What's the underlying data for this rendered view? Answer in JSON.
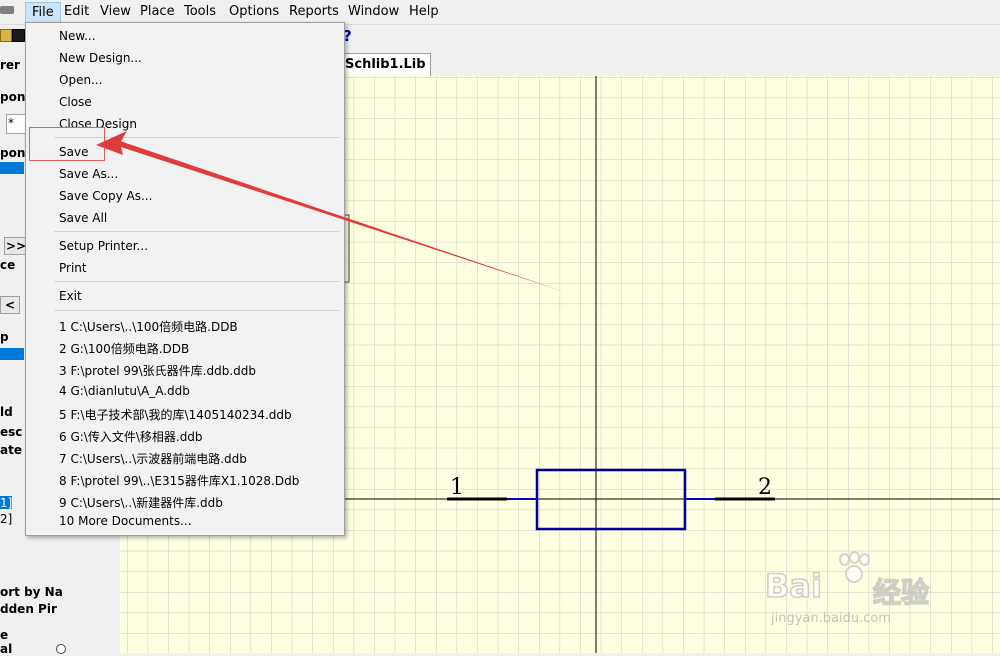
{
  "menubar": {
    "items": [
      "File",
      "Edit",
      "View",
      "Place",
      "Tools",
      "Options",
      "Reports",
      "Window",
      "Help"
    ]
  },
  "toolbar": {
    "help_glyph": "?"
  },
  "left_panel": {
    "rows": [
      "rer",
      "pon",
      "*",
      "pon",
      ">>",
      "ce",
      "<",
      "p",
      "ld",
      "esc",
      "ate S",
      "1]",
      "2]",
      "ort by Na",
      "dden Pir",
      "e",
      "al"
    ]
  },
  "document_tab": {
    "label": "Schlib1.Lib"
  },
  "schematic": {
    "pin1_label": "1",
    "pin2_label": "2",
    "grid_color": "#c8c8c8",
    "background_color": "#ffffe1",
    "body_color": "#0000a0"
  },
  "file_menu": {
    "items": [
      "New...",
      "New Design...",
      "Open...",
      "Close",
      "Close Design",
      "Save",
      "Save As...",
      "Save Copy As...",
      "Save All",
      "Setup Printer...",
      "Print",
      "Exit",
      "1 C:\\Users\\..\\100倍频电路.DDB",
      "2 G:\\100倍频电路.DDB",
      "3 F:\\protel 99\\张氏器件库.ddb.ddb",
      "4 G:\\dianlutu\\A_A.ddb",
      "5 F:\\电子技术部\\我的库\\1405140234.ddb",
      "6 G:\\传入文件\\移相器.ddb",
      "7 C:\\Users\\..\\示波器前端电路.ddb",
      "8 F:\\protel 99\\..\\E315器件库X1.1028.Ddb",
      "9 C:\\Users\\..\\新建器件库.ddb",
      "10 More Documents..."
    ]
  },
  "annotation": {
    "arrow_color": "#e03c3c"
  },
  "watermark": {
    "brand": "Bai",
    "brand_cn": "经验",
    "url": "jingyan.baidu.com"
  }
}
